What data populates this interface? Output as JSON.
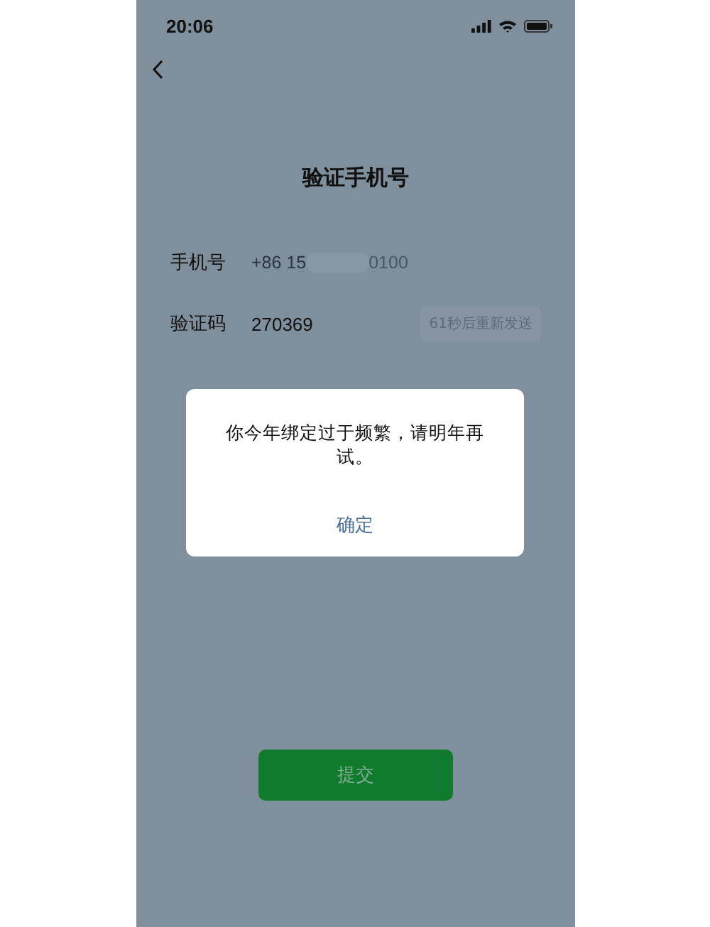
{
  "status_bar": {
    "time": "20:06"
  },
  "title": "验证手机号",
  "phone_row": {
    "label": "手机号",
    "value_start": "+86 15",
    "value_end": "0100"
  },
  "code_row": {
    "label": "验证码",
    "value": "270369",
    "resend_button": {
      "label": "61秒后重新发送",
      "disabled": true
    }
  },
  "dialog": {
    "message": "你今年绑定过于频繁，请明年再试。",
    "button": "确定"
  },
  "submit_button": {
    "label": "提交",
    "disabled": false
  }
}
